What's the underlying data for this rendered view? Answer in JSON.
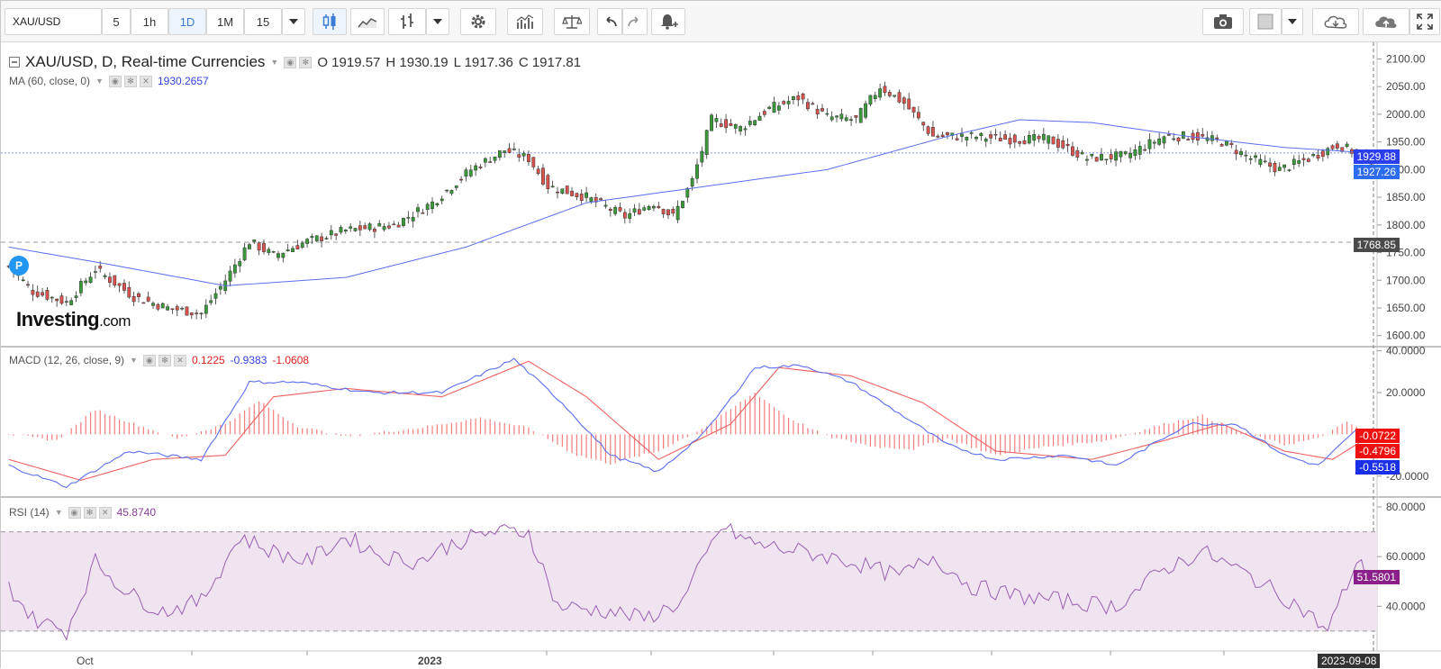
{
  "toolbar": {
    "symbol": "XAU/USD",
    "intervals": [
      "5",
      "1h",
      "1D",
      "1M",
      "15"
    ],
    "active_interval": "1D"
  },
  "main_legend": {
    "title": "XAU/USD, D, Real-time Currencies",
    "open": "O 1919.57",
    "high": "H 1930.19",
    "low": "L 1917.36",
    "close": "C 1917.81"
  },
  "ma_legend": {
    "label": "MA (60, close, 0)",
    "value": "1930.2657"
  },
  "macd_legend": {
    "label": "MACD (12, 26, close, 9)",
    "v1": "0.1225",
    "v2": "-0.9383",
    "v3": "-1.0608"
  },
  "rsi_legend": {
    "label": "RSI (14)",
    "value": "45.8740"
  },
  "brand": {
    "main": "Investing",
    "suffix": ".com"
  },
  "marker": {
    "label": "P"
  },
  "price_tags": {
    "ma": "1929.88",
    "last": "1927.26",
    "line": "1768.85",
    "macd_hist": "-0.0722",
    "macd_signal": "-0.4796",
    "macd_line": "-0.5518",
    "rsi": "51.5801"
  },
  "x_axis": {
    "labels": [
      "Oct",
      "2023"
    ],
    "current_date": "2023-09-08"
  },
  "colors": {
    "up": "#3a9a3a",
    "down": "#d9534f",
    "ma": "#5b6ef0",
    "macd": "#5b6ef0",
    "signal": "#f06262",
    "hist": "#f47c7c",
    "rsi": "#9b5fb4",
    "rsi_band": "#f1e4f1"
  },
  "chart_data": [
    {
      "type": "candlestick",
      "title": "XAU/USD, D, Real-time Currencies",
      "y_ticks": [
        2100,
        2050,
        2000,
        1950,
        1900,
        1850,
        1800,
        1750,
        1700,
        1650,
        1600
      ],
      "ylim": [
        1580,
        2130
      ],
      "x_ticks": [
        "Oct",
        "2023"
      ],
      "ohlc_anchor_points": [
        {
          "i": 0,
          "close": 1725
        },
        {
          "i": 5,
          "close": 1680
        },
        {
          "i": 12,
          "close": 1660
        },
        {
          "i": 18,
          "close": 1720
        },
        {
          "i": 26,
          "close": 1670
        },
        {
          "i": 33,
          "close": 1650
        },
        {
          "i": 40,
          "close": 1640
        },
        {
          "i": 45,
          "close": 1700
        },
        {
          "i": 50,
          "close": 1770
        },
        {
          "i": 55,
          "close": 1745
        },
        {
          "i": 62,
          "close": 1770
        },
        {
          "i": 70,
          "close": 1790
        },
        {
          "i": 80,
          "close": 1800
        },
        {
          "i": 88,
          "close": 1840
        },
        {
          "i": 96,
          "close": 1900
        },
        {
          "i": 103,
          "close": 1935
        },
        {
          "i": 108,
          "close": 1920
        },
        {
          "i": 112,
          "close": 1870
        },
        {
          "i": 120,
          "close": 1850
        },
        {
          "i": 128,
          "close": 1815
        },
        {
          "i": 134,
          "close": 1840
        },
        {
          "i": 138,
          "close": 1815
        },
        {
          "i": 142,
          "close": 1880
        },
        {
          "i": 146,
          "close": 1990
        },
        {
          "i": 152,
          "close": 1975
        },
        {
          "i": 158,
          "close": 2010
        },
        {
          "i": 164,
          "close": 2030
        },
        {
          "i": 170,
          "close": 1995
        },
        {
          "i": 176,
          "close": 1990
        },
        {
          "i": 181,
          "close": 2050
        },
        {
          "i": 186,
          "close": 2020
        },
        {
          "i": 192,
          "close": 1960
        },
        {
          "i": 200,
          "close": 1960
        },
        {
          "i": 208,
          "close": 1955
        },
        {
          "i": 216,
          "close": 1955
        },
        {
          "i": 224,
          "close": 1920
        },
        {
          "i": 232,
          "close": 1925
        },
        {
          "i": 240,
          "close": 1960
        },
        {
          "i": 246,
          "close": 1960
        },
        {
          "i": 252,
          "close": 1950
        },
        {
          "i": 258,
          "close": 1920
        },
        {
          "i": 264,
          "close": 1900
        },
        {
          "i": 270,
          "close": 1920
        },
        {
          "i": 276,
          "close": 1945
        },
        {
          "i": 280,
          "close": 1930
        },
        {
          "i": 283,
          "close": 1918
        }
      ],
      "series": [
        {
          "name": "MA (60, close, 0)",
          "points": [
            {
              "i": 0,
              "y": 1760
            },
            {
              "i": 20,
              "y": 1730
            },
            {
              "i": 45,
              "y": 1690
            },
            {
              "i": 70,
              "y": 1705
            },
            {
              "i": 95,
              "y": 1760
            },
            {
              "i": 120,
              "y": 1840
            },
            {
              "i": 145,
              "y": 1870
            },
            {
              "i": 170,
              "y": 1900
            },
            {
              "i": 195,
              "y": 1960
            },
            {
              "i": 210,
              "y": 1990
            },
            {
              "i": 225,
              "y": 1985
            },
            {
              "i": 245,
              "y": 1960
            },
            {
              "i": 265,
              "y": 1940
            },
            {
              "i": 283,
              "y": 1930
            }
          ]
        }
      ],
      "horizontal_line": 1768.85
    },
    {
      "type": "line",
      "title": "MACD (12, 26, close, 9)",
      "y_ticks": [
        40,
        20,
        -20
      ],
      "ylim": [
        -30,
        42
      ],
      "series": [
        {
          "name": "MACD",
          "points": [
            {
              "i": 0,
              "y": -15
            },
            {
              "i": 12,
              "y": -25
            },
            {
              "i": 25,
              "y": -8
            },
            {
              "i": 40,
              "y": -12
            },
            {
              "i": 50,
              "y": 25
            },
            {
              "i": 60,
              "y": 25
            },
            {
              "i": 75,
              "y": 20
            },
            {
              "i": 90,
              "y": 20
            },
            {
              "i": 105,
              "y": 36
            },
            {
              "i": 115,
              "y": 15
            },
            {
              "i": 125,
              "y": -10
            },
            {
              "i": 135,
              "y": -18
            },
            {
              "i": 145,
              "y": 2
            },
            {
              "i": 155,
              "y": 32
            },
            {
              "i": 165,
              "y": 33
            },
            {
              "i": 175,
              "y": 25
            },
            {
              "i": 185,
              "y": 10
            },
            {
              "i": 195,
              "y": -5
            },
            {
              "i": 205,
              "y": -12
            },
            {
              "i": 220,
              "y": -10
            },
            {
              "i": 230,
              "y": -15
            },
            {
              "i": 245,
              "y": 5
            },
            {
              "i": 255,
              "y": 5
            },
            {
              "i": 265,
              "y": -10
            },
            {
              "i": 272,
              "y": -15
            },
            {
              "i": 280,
              "y": 2
            },
            {
              "i": 283,
              "y": -0.55
            }
          ]
        },
        {
          "name": "Signal",
          "points": [
            {
              "i": 0,
              "y": -12
            },
            {
              "i": 15,
              "y": -22
            },
            {
              "i": 30,
              "y": -12
            },
            {
              "i": 45,
              "y": -10
            },
            {
              "i": 55,
              "y": 18
            },
            {
              "i": 70,
              "y": 22
            },
            {
              "i": 90,
              "y": 18
            },
            {
              "i": 108,
              "y": 35
            },
            {
              "i": 120,
              "y": 18
            },
            {
              "i": 135,
              "y": -12
            },
            {
              "i": 150,
              "y": 5
            },
            {
              "i": 160,
              "y": 32
            },
            {
              "i": 175,
              "y": 28
            },
            {
              "i": 190,
              "y": 15
            },
            {
              "i": 205,
              "y": -8
            },
            {
              "i": 225,
              "y": -12
            },
            {
              "i": 240,
              "y": -3
            },
            {
              "i": 252,
              "y": 5
            },
            {
              "i": 265,
              "y": -8
            },
            {
              "i": 275,
              "y": -12
            },
            {
              "i": 283,
              "y": -0.48
            }
          ]
        }
      ],
      "histogram_anchor_points": [
        {
          "i": 0,
          "y": 0
        },
        {
          "i": 10,
          "y": -3
        },
        {
          "i": 18,
          "y": 12
        },
        {
          "i": 25,
          "y": 6
        },
        {
          "i": 35,
          "y": -2
        },
        {
          "i": 45,
          "y": 5
        },
        {
          "i": 52,
          "y": 16
        },
        {
          "i": 60,
          "y": 4
        },
        {
          "i": 70,
          "y": -1
        },
        {
          "i": 85,
          "y": 3
        },
        {
          "i": 98,
          "y": 8
        },
        {
          "i": 108,
          "y": 3
        },
        {
          "i": 118,
          "y": -10
        },
        {
          "i": 125,
          "y": -14
        },
        {
          "i": 135,
          "y": -8
        },
        {
          "i": 145,
          "y": 4
        },
        {
          "i": 155,
          "y": 20
        },
        {
          "i": 162,
          "y": 8
        },
        {
          "i": 170,
          "y": -1
        },
        {
          "i": 180,
          "y": -6
        },
        {
          "i": 188,
          "y": -7
        },
        {
          "i": 195,
          "y": -2
        },
        {
          "i": 205,
          "y": -10
        },
        {
          "i": 215,
          "y": -6
        },
        {
          "i": 228,
          "y": -3
        },
        {
          "i": 240,
          "y": 5
        },
        {
          "i": 248,
          "y": 9
        },
        {
          "i": 255,
          "y": 2
        },
        {
          "i": 265,
          "y": -5
        },
        {
          "i": 272,
          "y": -2
        },
        {
          "i": 278,
          "y": 6
        },
        {
          "i": 283,
          "y": 0
        }
      ]
    },
    {
      "type": "line",
      "title": "RSI (14)",
      "y_ticks": [
        80,
        60,
        40
      ],
      "ylim": [
        22,
        84
      ],
      "band": [
        30,
        70
      ],
      "series": [
        {
          "name": "RSI",
          "points": [
            {
              "i": 0,
              "y": 48
            },
            {
              "i": 5,
              "y": 35
            },
            {
              "i": 12,
              "y": 30
            },
            {
              "i": 18,
              "y": 58
            },
            {
              "i": 25,
              "y": 45
            },
            {
              "i": 32,
              "y": 38
            },
            {
              "i": 40,
              "y": 42
            },
            {
              "i": 48,
              "y": 68
            },
            {
              "i": 55,
              "y": 62
            },
            {
              "i": 62,
              "y": 58
            },
            {
              "i": 70,
              "y": 68
            },
            {
              "i": 78,
              "y": 60
            },
            {
              "i": 85,
              "y": 58
            },
            {
              "i": 92,
              "y": 65
            },
            {
              "i": 100,
              "y": 70
            },
            {
              "i": 108,
              "y": 70
            },
            {
              "i": 114,
              "y": 40
            },
            {
              "i": 125,
              "y": 38
            },
            {
              "i": 132,
              "y": 35
            },
            {
              "i": 140,
              "y": 42
            },
            {
              "i": 148,
              "y": 72
            },
            {
              "i": 155,
              "y": 65
            },
            {
              "i": 165,
              "y": 62
            },
            {
              "i": 175,
              "y": 58
            },
            {
              "i": 185,
              "y": 52
            },
            {
              "i": 192,
              "y": 60
            },
            {
              "i": 200,
              "y": 48
            },
            {
              "i": 210,
              "y": 44
            },
            {
              "i": 220,
              "y": 42
            },
            {
              "i": 230,
              "y": 40
            },
            {
              "i": 240,
              "y": 55
            },
            {
              "i": 248,
              "y": 62
            },
            {
              "i": 258,
              "y": 52
            },
            {
              "i": 268,
              "y": 40
            },
            {
              "i": 274,
              "y": 30
            },
            {
              "i": 280,
              "y": 58
            },
            {
              "i": 283,
              "y": 51.58
            }
          ]
        }
      ]
    }
  ]
}
